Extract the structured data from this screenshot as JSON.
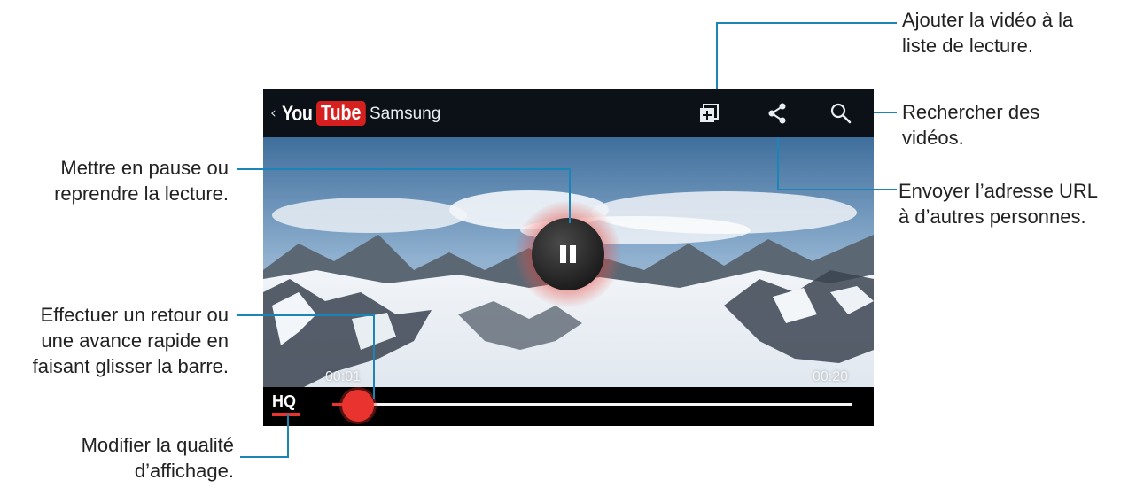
{
  "header": {
    "back_glyph": "‹",
    "logo_you": "You",
    "logo_tube": "Tube",
    "channel": "Samsung"
  },
  "player": {
    "elapsed": "00:01",
    "duration": "00:20",
    "progress_fraction": 0.05,
    "quality_label": "HQ"
  },
  "icons": [
    "add-to-playlist-icon",
    "share-icon",
    "search-icon",
    "pause-icon"
  ],
  "colors": {
    "accent_red": "#e8332f",
    "callout_line": "#1c85b8",
    "topbar": "#0c1117"
  },
  "callouts": {
    "playlist": [
      "Ajouter la vidéo à la",
      "liste de lecture."
    ],
    "search": [
      "Rechercher des",
      "vidéos."
    ],
    "share": [
      "Envoyer l’adresse URL",
      "à d’autres personnes."
    ],
    "pause": [
      "Mettre en pause ou",
      "reprendre la lecture."
    ],
    "seek": [
      "Effectuer un retour ou",
      "une avance rapide en",
      "faisant glisser la barre."
    ],
    "quality": [
      "Modifier la qualité",
      "d’affichage."
    ]
  }
}
